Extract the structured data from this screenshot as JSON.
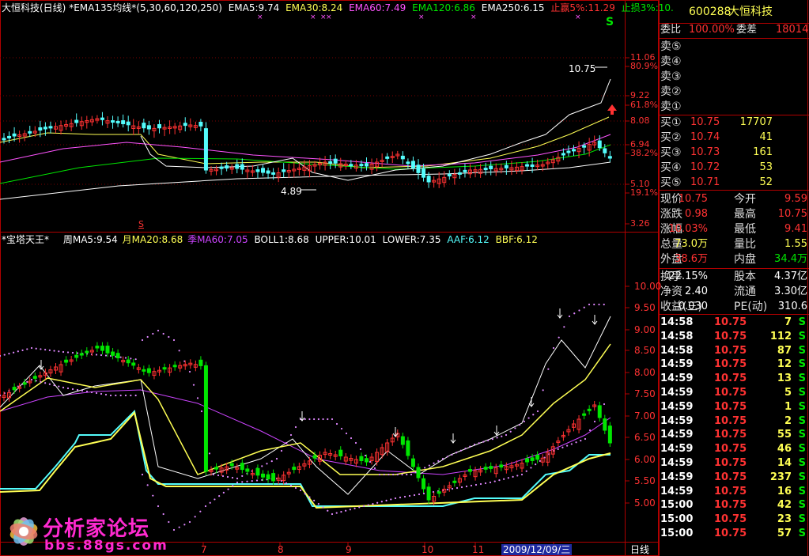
{
  "colors": {
    "up": "#ff3232",
    "down": "#54fcfc",
    "grid": "#b00000",
    "yellow": "#ffff54",
    "green": "#00e600",
    "magenta": "#cc44ff",
    "white": "#ffffff"
  },
  "main_header": {
    "title": "大恒科技(日线)",
    "ema_title": "*EMA135均线*",
    "params": "(5,30,60,120,250)",
    "ema5": "EMA5:9.74",
    "ema30": "EMA30:8.24",
    "ema60": "EMA60:7.49",
    "ema120": "EMA120:6.86",
    "ema250": "EMA250:6.15",
    "stop_win": "止赢5%:11.29",
    "stop_loss": "止损3%:10."
  },
  "main_axis": {
    "labels": [
      "11.06",
      "80.9%",
      "9.22",
      "61.8%",
      "8.08",
      "6.94",
      "38.2%",
      "5.10",
      "19.1%",
      "3.26"
    ]
  },
  "main_annotations": {
    "high": "10.75",
    "low": "4.89",
    "s_marker": "S",
    "s_small": "S"
  },
  "sub_header": {
    "title": "*宝塔天王*",
    "wma5": "周MA5:9.54",
    "mma20": "月MA20:8.68",
    "qma60": "季MA60:7.05",
    "boll": "BOLL1:8.68",
    "upper": "UPPER:10.01",
    "lower": "LOWER:7.35",
    "aaf": "AAF:6.12",
    "bbf": "BBF:6.12"
  },
  "sub_axis": {
    "labels": [
      "10.00",
      "9.50",
      "9.00",
      "8.50",
      "8.00",
      "7.50",
      "7.00",
      "6.50",
      "6.00",
      "5.50",
      "5.00"
    ]
  },
  "x_axis": {
    "labels": [
      "7",
      "8",
      "9",
      "10",
      "11"
    ],
    "cursor_date": "2009/12/09/三",
    "period": "日线"
  },
  "watermark": {
    "name": "分析家论坛",
    "url": "bbs.88gs.com"
  },
  "quote": {
    "code": "600288",
    "name": "大恒科技",
    "weibi_label": "委比",
    "weibi": "100.00%",
    "weicha_label": "委差",
    "weicha": "18014",
    "sell": [
      {
        "label": "卖⑤"
      },
      {
        "label": "卖④"
      },
      {
        "label": "卖③"
      },
      {
        "label": "卖②"
      },
      {
        "label": "卖①"
      }
    ],
    "buy": [
      {
        "label": "买①",
        "price": "10.75",
        "vol": "17707"
      },
      {
        "label": "买②",
        "price": "10.74",
        "vol": "41"
      },
      {
        "label": "买③",
        "price": "10.73",
        "vol": "161"
      },
      {
        "label": "买④",
        "price": "10.72",
        "vol": "53"
      },
      {
        "label": "买⑤",
        "price": "10.71",
        "vol": "52"
      }
    ],
    "stats": [
      {
        "l1": "现价",
        "v1": "10.75",
        "l2": "今开",
        "v2": "9.59"
      },
      {
        "l1": "涨跌",
        "v1": "0.98",
        "l2": "最高",
        "v2": "10.75"
      },
      {
        "l1": "涨幅",
        "v1": "10.03%",
        "l2": "最低",
        "v2": "9.41"
      },
      {
        "l1": "总量",
        "v1": "73.0万",
        "l2": "量比",
        "v2": "1.55"
      },
      {
        "l1": "外盘",
        "v1": "38.6万",
        "l2": "内盘",
        "v2": "34.4万"
      }
    ],
    "stats2": [
      {
        "l1": "换手",
        "v1": "22.15%",
        "l2": "股本",
        "v2": "4.37亿"
      },
      {
        "l1": "净资",
        "v1": "2.40",
        "l2": "流通",
        "v2": "3.30亿"
      },
      {
        "l1": "收益(三)",
        "v1": "0.030",
        "l2": "PE(动)",
        "v2": "310.6"
      }
    ],
    "ticks": [
      {
        "time": "14:58",
        "price": "10.75",
        "vol": "7",
        "bs": "S"
      },
      {
        "time": "14:58",
        "price": "10.75",
        "vol": "112",
        "bs": "S"
      },
      {
        "time": "14:58",
        "price": "10.75",
        "vol": "87",
        "bs": "S"
      },
      {
        "time": "14:59",
        "price": "10.75",
        "vol": "12",
        "bs": "S"
      },
      {
        "time": "14:59",
        "price": "10.75",
        "vol": "13",
        "bs": "S"
      },
      {
        "time": "14:59",
        "price": "10.75",
        "vol": "5",
        "bs": "S"
      },
      {
        "time": "14:59",
        "price": "10.75",
        "vol": "1",
        "bs": "S"
      },
      {
        "time": "14:59",
        "price": "10.75",
        "vol": "2",
        "bs": "S"
      },
      {
        "time": "14:59",
        "price": "10.75",
        "vol": "55",
        "bs": "S"
      },
      {
        "time": "14:59",
        "price": "10.75",
        "vol": "46",
        "bs": "S"
      },
      {
        "time": "14:59",
        "price": "10.75",
        "vol": "14",
        "bs": "S"
      },
      {
        "time": "14:59",
        "price": "10.75",
        "vol": "237",
        "bs": "S"
      },
      {
        "time": "14:59",
        "price": "10.75",
        "vol": "16",
        "bs": "S"
      },
      {
        "time": "15:00",
        "price": "10.75",
        "vol": "42",
        "bs": "S"
      },
      {
        "time": "15:00",
        "price": "10.75",
        "vol": "23",
        "bs": "S"
      },
      {
        "time": "15:00",
        "price": "10.75",
        "vol": "57",
        "bs": "S"
      }
    ]
  }
}
